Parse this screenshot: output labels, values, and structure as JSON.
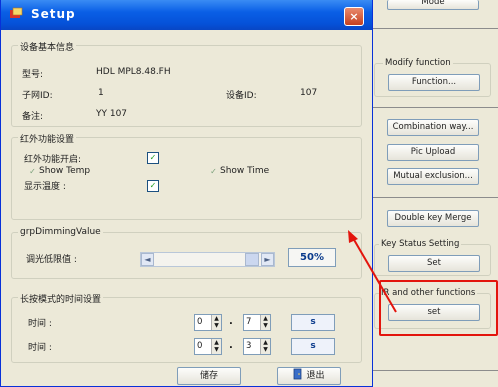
{
  "dialog": {
    "title": "Setup",
    "close_glyph": "×",
    "basic_info": {
      "group_title": "设备基本信息",
      "model_label": "型号:",
      "model_value": "HDL MPL8.48.FH",
      "subnet_label": "子网ID:",
      "subnet_value": "1",
      "device_label": "设备ID:",
      "device_value": "107",
      "remark_label": "备注:",
      "remark_value": "YY 107"
    },
    "ir_settings": {
      "group_title": "红外功能设置",
      "ir_enable_label": "红外功能开启:",
      "show_temp_label": "Show Temp",
      "show_time_label": "Show Time",
      "display_label": "显示温度 :",
      "check_glyph": "✓"
    },
    "dimming": {
      "group_title": "grpDimmingValue",
      "threshold_label": "调光低限值 :",
      "left_arrow": "◄",
      "right_arrow": "►",
      "percent": "50%"
    },
    "long_press": {
      "group_title": "长按模式的时间设置",
      "row1": {
        "label": "时间 :",
        "a": "0",
        "sep": ".",
        "b": "7",
        "unit": "s"
      },
      "row2": {
        "label": "时间 :",
        "a": "0",
        "sep": ".",
        "b": "3",
        "unit": "s"
      },
      "spin_up": "▲",
      "spin_down": "▼"
    },
    "buttons": {
      "save": "储存",
      "exit": "退出"
    }
  },
  "right_panel": {
    "top_button": "Mode",
    "modify_label": "Modify function",
    "function_button": "Function...",
    "combination_button": "Combination way...",
    "pic_upload_button": "Pic Upload",
    "mutual_button": "Mutual exclusion...",
    "double_key_button": "Double key Merge",
    "key_status_label": "Key Status Setting",
    "key_status_set_button": "Set",
    "ir_other_label": "IR and other functions",
    "ir_other_set_button": "set"
  },
  "colors": {
    "annotation": "#e3150d",
    "titlebar": "#0551d8",
    "window_bg": "#ece9d8"
  }
}
